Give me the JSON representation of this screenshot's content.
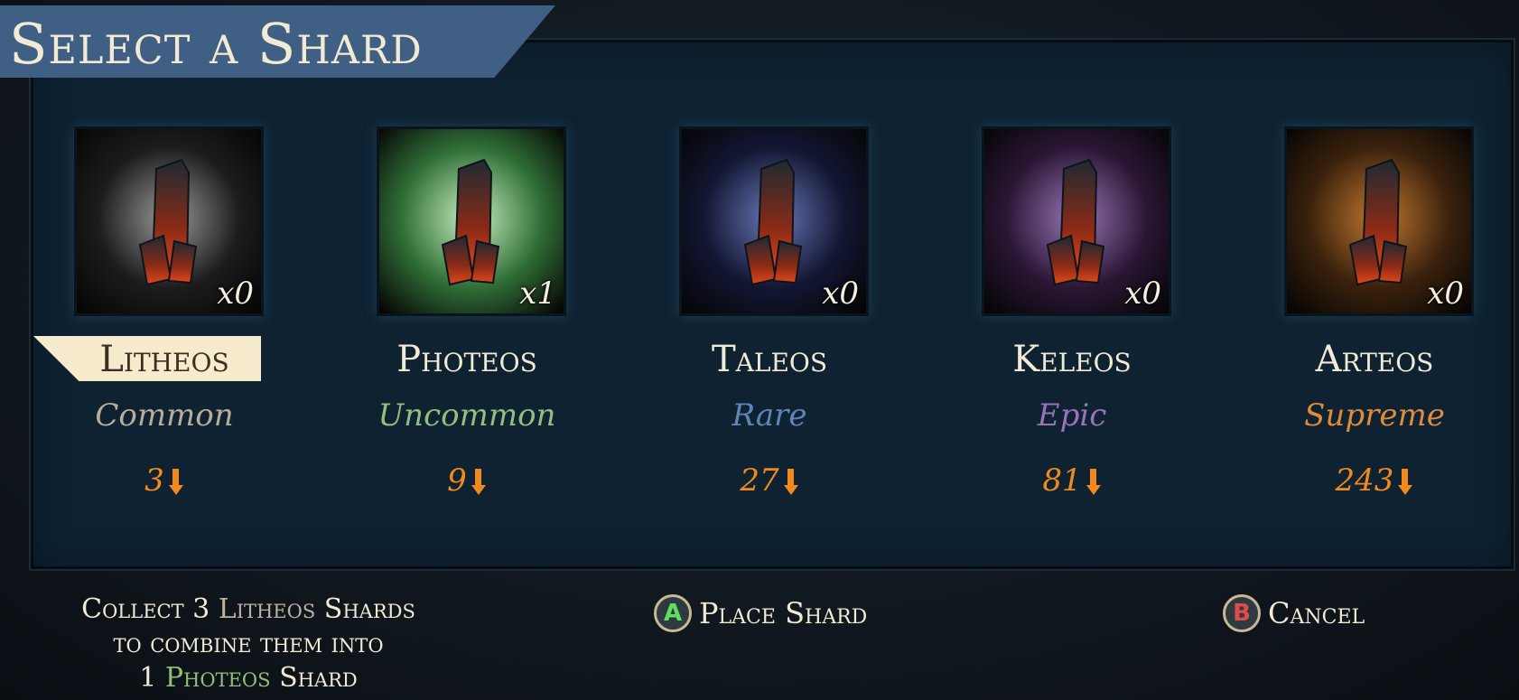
{
  "title": "Select a Shard",
  "colors": {
    "accent_banner": "#3f5f84",
    "cost": "#f08a1c",
    "selected_bg": "#f6ebcc"
  },
  "shards": [
    {
      "name": "Litheos",
      "rarity": "Common",
      "rarity_color": "#b7ad9a",
      "count": "x0",
      "cost": "3",
      "glow": "#9a9a9a",
      "bg": "#1c1c1c",
      "selected": true
    },
    {
      "name": "Photeos",
      "rarity": "Uncommon",
      "rarity_color": "#8fc07c",
      "count": "x1",
      "cost": "9",
      "glow": "#c8f0c0",
      "bg": "#2f6d36",
      "selected": false
    },
    {
      "name": "Taleos",
      "rarity": "Rare",
      "rarity_color": "#5f85b8",
      "count": "x0",
      "cost": "27",
      "glow": "#6a78b8",
      "bg": "#121632",
      "selected": false
    },
    {
      "name": "Keleos",
      "rarity": "Epic",
      "rarity_color": "#9a72ba",
      "count": "x0",
      "cost": "81",
      "glow": "#9a76b8",
      "bg": "#2a1634",
      "selected": false
    },
    {
      "name": "Arteos",
      "rarity": "Supreme",
      "rarity_color": "#e08a3c",
      "count": "x0",
      "cost": "243",
      "glow": "#c27830",
      "bg": "#3a210c",
      "selected": false
    }
  ],
  "footer": {
    "line1_pre": "Collect 3 ",
    "line1_hl": "Litheos",
    "line1_post": " Shards",
    "line2": "to combine them into",
    "line3_pre": "1 ",
    "line3_hl": "Photeos",
    "line3_post": " Shard"
  },
  "buttons": {
    "place": {
      "key": "A",
      "key_color": "#5fe05a",
      "label": "Place Shard"
    },
    "cancel": {
      "key": "B",
      "key_color": "#e34a4a",
      "label": "Cancel"
    }
  },
  "icons": {
    "cost_icon": "orange-shard-arrow-icon"
  }
}
